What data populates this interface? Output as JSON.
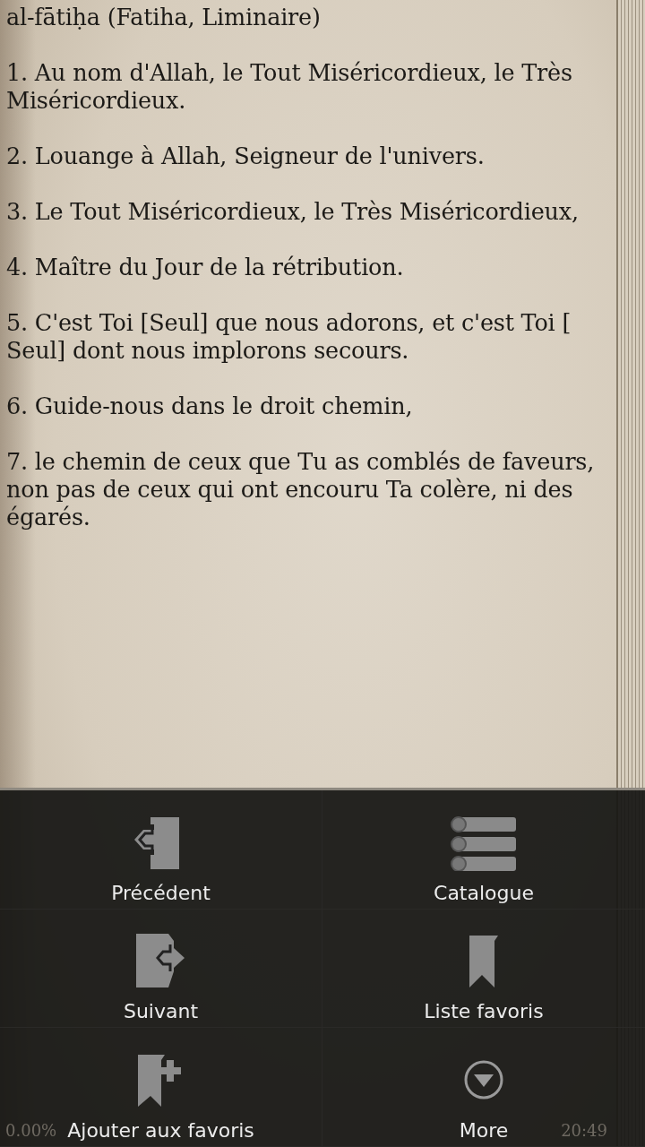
{
  "reader": {
    "title": "al-fātiḥa (Fatiha, Liminaire)",
    "verses": [
      "1. Au nom d'Allah, le Tout Miséricordieux, le Très Miséricordieux.",
      "2. Louange à Allah, Seigneur de l'univers.",
      "3. Le Tout Miséricordieux, le Très Miséricordieux,",
      "4. Maître du Jour de la rétribution.",
      "5. C'est Toi [Seul] que nous adorons, et c'est Toi [ Seul] dont nous implorons secours.",
      "6. Guide-nous dans le droit chemin,",
      "7. le chemin de ceux que Tu as comblés de faveurs, non pas de ceux qui ont encouru Ta colère, ni des égarés."
    ]
  },
  "status_bar": {
    "progress": "0.00%",
    "time": "20:49"
  },
  "menu": [
    {
      "kind": "previous",
      "label": "Précédent"
    },
    {
      "kind": "catalog",
      "label": "Catalogue"
    },
    {
      "kind": "next",
      "label": "Suivant"
    },
    {
      "kind": "bookmarks",
      "label": "Liste favoris"
    },
    {
      "kind": "add-bookmark",
      "label": "Ajouter aux favoris"
    },
    {
      "kind": "more",
      "label": "More"
    }
  ]
}
